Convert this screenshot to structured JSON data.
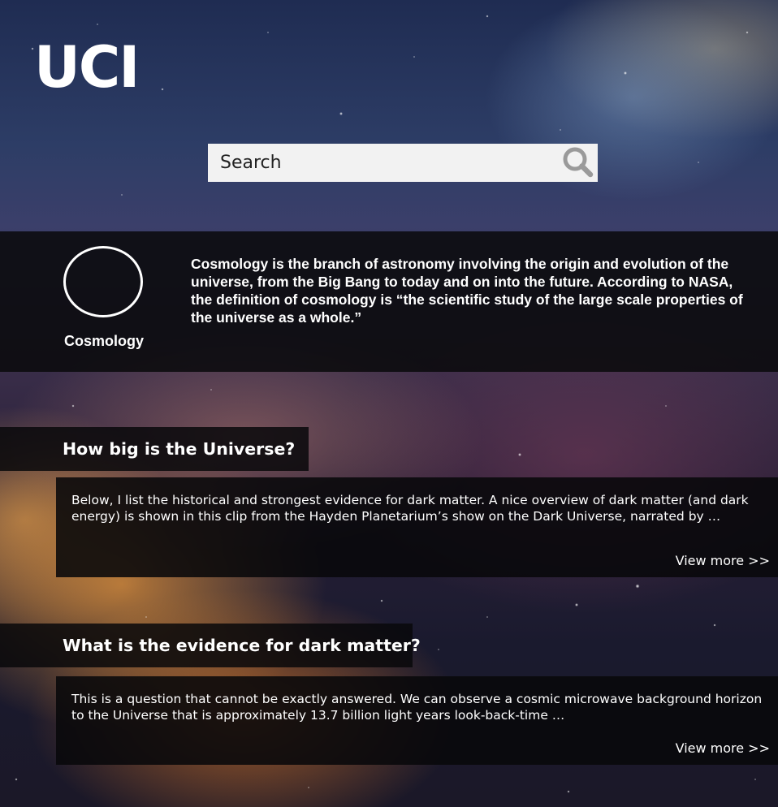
{
  "header": {
    "logo_text": "UCI"
  },
  "search": {
    "placeholder": "Search",
    "icon": "search-icon"
  },
  "intro": {
    "topic_label": "Cosmology",
    "text": "Cosmology is the branch of astronomy involving the origin and evolution of the universe, from the Big Bang to today and on into the future. According to NASA, the definition of cosmology is “the scientific study of the large scale properties of the universe as a whole.”"
  },
  "questions": [
    {
      "title": "How big is the Universe?",
      "excerpt": "Below, I list the historical and strongest evidence for dark matter. A nice overview of dark matter (and dark energy) is shown in this clip from the Hayden Planetarium’s show on the Dark Universe, narrated by …",
      "view_more": "View more >>"
    },
    {
      "title": "What is the evidence for dark matter?",
      "excerpt": "This is a question that cannot be exactly answered. We can observe a cosmic microwave background horizon to the Universe that is approximately 13.7 billion light years look-back-time …",
      "view_more": "View more >>"
    }
  ],
  "colors": {
    "panel_bg": "#0a0a0c",
    "search_bg": "#f2f2f2",
    "search_icon": "#9a9a9a",
    "text": "#ffffff"
  }
}
